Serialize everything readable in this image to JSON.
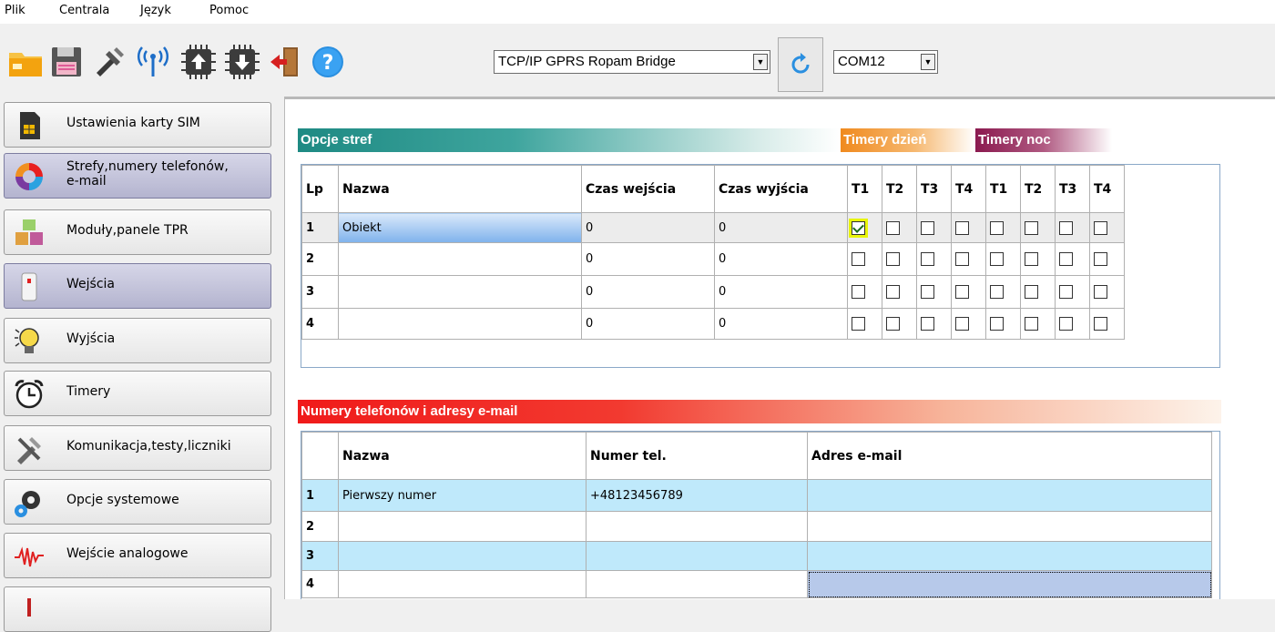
{
  "menu": {
    "file": "Plik",
    "central": "Centrala",
    "language": "Język",
    "help": "Pomoc"
  },
  "toolbar": {
    "connection_value": "TCP/IP GPRS Ropam Bridge",
    "port_value": "COM12",
    "icons": [
      "folder-icon",
      "save-icon",
      "tools-icon",
      "antenna-icon",
      "chip-upload-icon",
      "chip-download-icon",
      "exit-icon",
      "help-icon",
      "refresh-icon"
    ]
  },
  "sidebar": {
    "items": [
      {
        "label": "Ustawienia karty SIM"
      },
      {
        "label": "Strefy,numery telefonów, e-mail",
        "line1": "Strefy,numery telefonów,",
        "line2": "e-mail"
      },
      {
        "label": "Moduły,panele TPR"
      },
      {
        "label": "Wejścia"
      },
      {
        "label": "Wyjścia"
      },
      {
        "label": "Timery"
      },
      {
        "label": "Komunikacja,testy,liczniki"
      },
      {
        "label": "Opcje systemowe"
      },
      {
        "label": "Wejście analogowe"
      }
    ]
  },
  "zones": {
    "title": "Opcje stref",
    "timers_day": "Timery dzień",
    "timers_night": "Timery noc",
    "headers": {
      "lp": "Lp",
      "name": "Nazwa",
      "entry": "Czas wejścia",
      "exit": "Czas wyjścia",
      "t1": "T1",
      "t2": "T2",
      "t3": "T3",
      "t4": "T4"
    },
    "rows": [
      {
        "lp": "1",
        "name": "Obiekt",
        "entry": "0",
        "exit": "0"
      },
      {
        "lp": "2",
        "name": "",
        "entry": "0",
        "exit": "0"
      },
      {
        "lp": "3",
        "name": "",
        "entry": "0",
        "exit": "0"
      },
      {
        "lp": "4",
        "name": "",
        "entry": "0",
        "exit": "0"
      }
    ],
    "checked_cell": "row1-day-T1"
  },
  "phones": {
    "title": "Numery telefonów i adresy e-mail",
    "headers": {
      "name": "Nazwa",
      "number": "Numer tel.",
      "email": "Adres e-mail"
    },
    "rows": [
      {
        "lp": "1",
        "name": "Pierwszy numer",
        "number": "+48123456789",
        "email": ""
      },
      {
        "lp": "2",
        "name": "",
        "number": "",
        "email": ""
      },
      {
        "lp": "3",
        "name": "",
        "number": "",
        "email": ""
      },
      {
        "lp": "4",
        "name": "",
        "number": "",
        "email": ""
      }
    ]
  },
  "colors": {
    "zones_header": "#1e8a83",
    "timers_day": "#f08a1e",
    "timers_night": "#8b1a4f",
    "phones_header": "#f01a1a",
    "row_alt": "#bfe9fb"
  }
}
